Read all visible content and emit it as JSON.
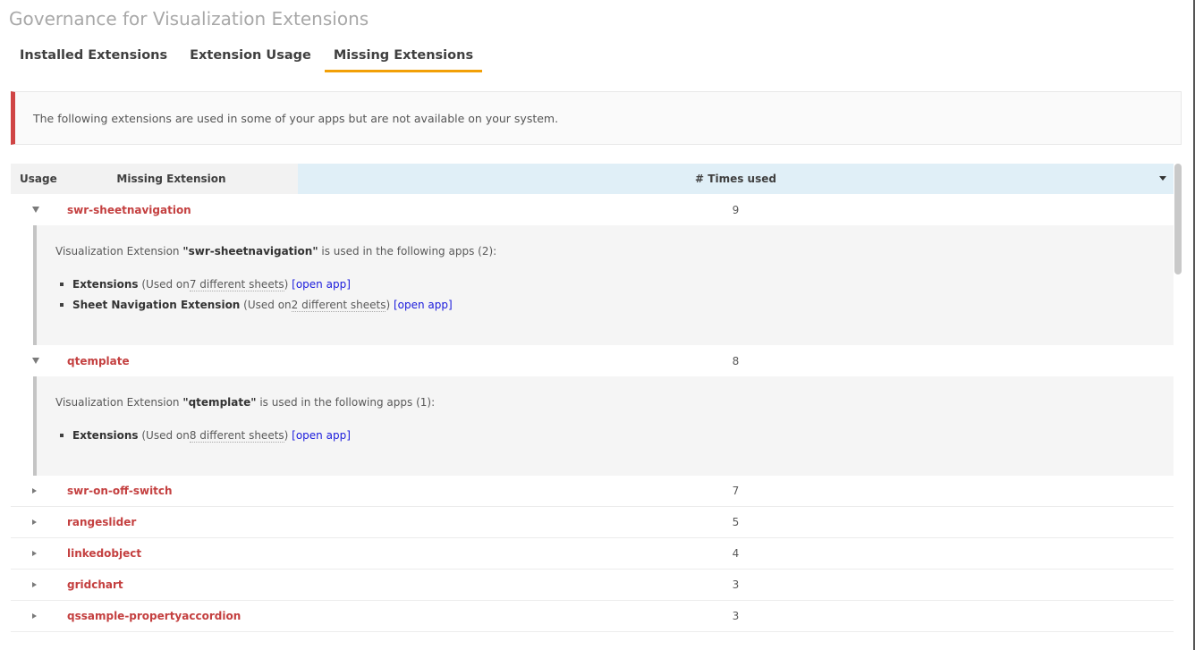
{
  "page": {
    "title": "Governance for Visualization Extensions"
  },
  "tabs": [
    {
      "label": "Installed Extensions",
      "active": false
    },
    {
      "label": "Extension Usage",
      "active": false
    },
    {
      "label": "Missing Extensions",
      "active": true
    }
  ],
  "alert": {
    "text": "The following extensions are used in some of your apps but are not available on your system."
  },
  "table": {
    "headers": {
      "usage": "Usage",
      "extension": "Missing Extension",
      "times": "# Times used"
    },
    "rows": [
      {
        "name": "swr-sheetnavigation",
        "count": "9",
        "expanded": true,
        "detail": {
          "prefix": "Visualization Extension ",
          "name": "\"swr-sheetnavigation\"",
          "suffix": " is used in the following apps (2):",
          "apps": [
            {
              "name": "Extensions",
              "pre": " (Used on",
              "sheets": "7 different sheets",
              "post": ") ",
              "link": "[open app]"
            },
            {
              "name": "Sheet Navigation Extension",
              "pre": " (Used on",
              "sheets": "2 different sheets",
              "post": ") ",
              "link": "[open app]"
            }
          ]
        }
      },
      {
        "name": "qtemplate",
        "count": "8",
        "expanded": true,
        "detail": {
          "prefix": "Visualization Extension ",
          "name": "\"qtemplate\"",
          "suffix": " is used in the following apps (1):",
          "apps": [
            {
              "name": "Extensions",
              "pre": " (Used on",
              "sheets": "8 different sheets",
              "post": ") ",
              "link": "[open app]"
            }
          ]
        }
      },
      {
        "name": "swr-on-off-switch",
        "count": "7",
        "expanded": false
      },
      {
        "name": "rangeslider",
        "count": "5",
        "expanded": false
      },
      {
        "name": "linkedobject",
        "count": "4",
        "expanded": false
      },
      {
        "name": "gridchart",
        "count": "3",
        "expanded": false
      },
      {
        "name": "qssample-propertyaccordion",
        "count": "3",
        "expanded": false
      }
    ]
  },
  "colors": {
    "accent_tab": "#f2a007",
    "alert_border": "#d04545",
    "extension_name": "#c44040",
    "link": "#1a1adc",
    "sorted_header": "#e0eff7"
  }
}
